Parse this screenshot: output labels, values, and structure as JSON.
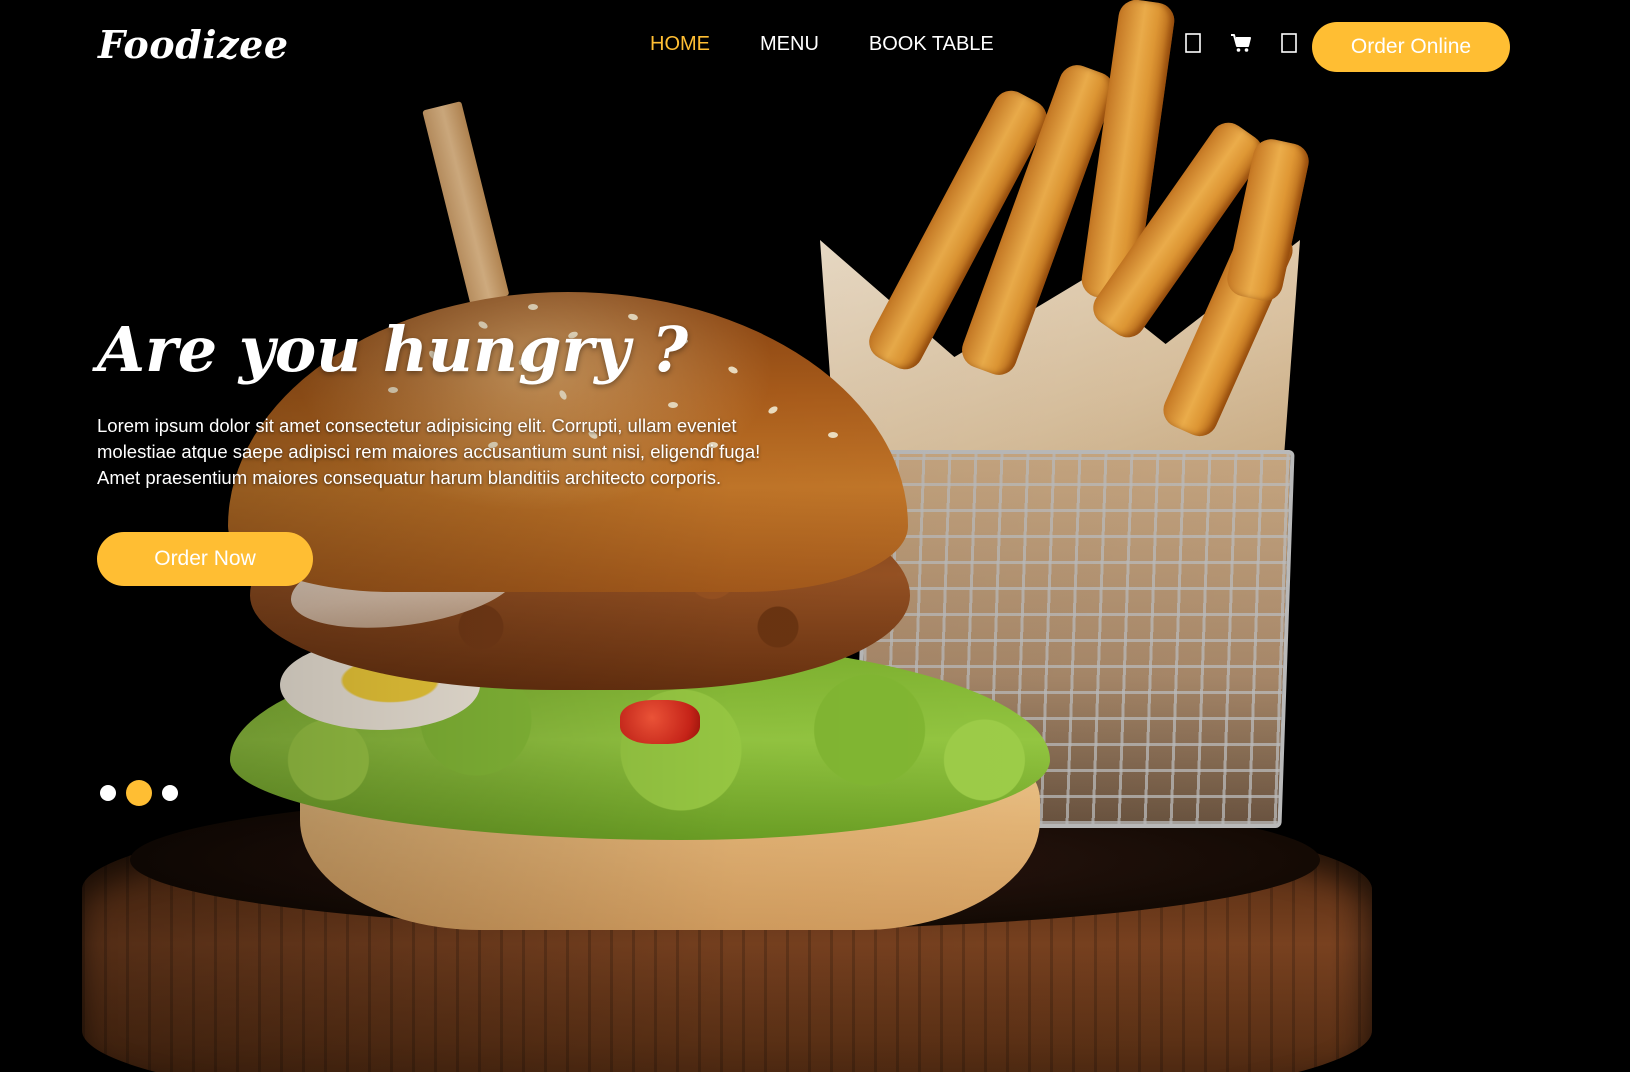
{
  "brand": {
    "logo": "Foodizee",
    "accent_color": "#ffbe33"
  },
  "nav": {
    "items": [
      {
        "label": "HOME",
        "active": true
      },
      {
        "label": "MENU",
        "active": false
      },
      {
        "label": "BOOK TABLE",
        "active": false
      }
    ]
  },
  "header_icons": [
    {
      "name": "user-icon"
    },
    {
      "name": "cart-icon"
    },
    {
      "name": "search-icon"
    }
  ],
  "header": {
    "order_online_label": "Order Online"
  },
  "hero": {
    "title": "Are you hungry ?",
    "text": "Lorem ipsum dolor sit amet consectetur adipisicing elit. Corrupti, ullam eveniet molestiae atque saepe adipisci rem maiores accusantium sunt nisi, eligendi fuga! Amet praesentium maiores consequatur harum blanditiis architecto corporis.",
    "order_now_label": "Order Now",
    "image": "burger-and-fries-image"
  },
  "carousel": {
    "slides": 3,
    "active_index": 1
  }
}
